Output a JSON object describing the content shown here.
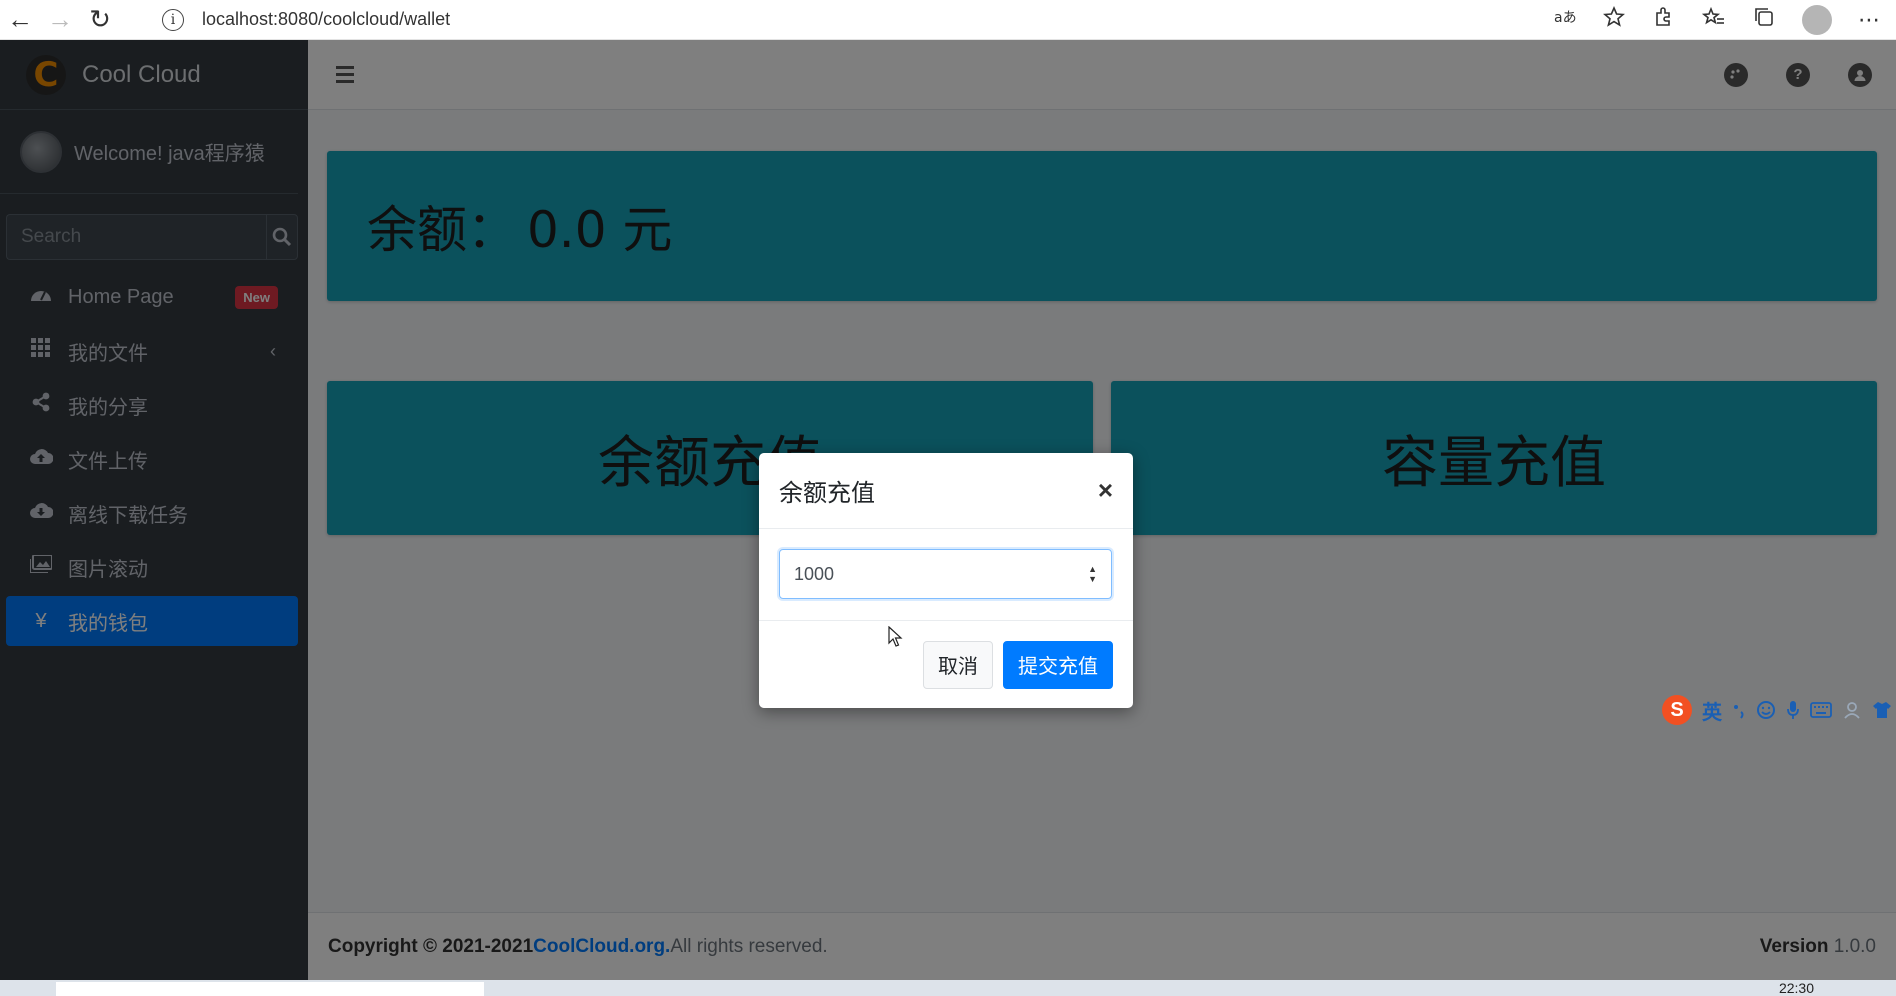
{
  "browser": {
    "url": "localhost:8080/coolcloud/wallet",
    "info_symbol": "i"
  },
  "sidebar": {
    "brand": "Cool Cloud",
    "brand_logo_letter": "C",
    "welcome": "Welcome! java程序猿",
    "search_placeholder": "Search",
    "items": [
      {
        "label": "Home Page",
        "icon": "dashboard-icon",
        "badge": "New"
      },
      {
        "label": "我的文件",
        "icon": "grid-icon",
        "chevron": "‹"
      },
      {
        "label": "我的分享",
        "icon": "share-icon"
      },
      {
        "label": "文件上传",
        "icon": "cloud-upload-icon"
      },
      {
        "label": "离线下载任务",
        "icon": "cloud-download-icon"
      },
      {
        "label": "图片滚动",
        "icon": "images-icon"
      },
      {
        "label": "我的钱包",
        "icon": "yen-icon",
        "active": true
      }
    ]
  },
  "main": {
    "balance_label": "余额：",
    "balance_value": "0.0 元",
    "actions": [
      "余额充值",
      "容量充值"
    ]
  },
  "modal": {
    "title": "余额充值",
    "close": "×",
    "amount_value": "1000",
    "cancel": "取消",
    "submit": "提交充值"
  },
  "footer": {
    "copyright_prefix": "Copyright © 2021-2021 ",
    "org": "CoolCloud.org.",
    "rights": " All rights reserved.",
    "version_label": "Version",
    "version_value": "1.0.0"
  },
  "ime": {
    "logo": "S",
    "lang": "英"
  },
  "taskbar": {
    "time": "22:30"
  },
  "colors": {
    "sidebar_bg": "#343a40",
    "info_box": "#17a2b8",
    "primary": "#007bff",
    "danger": "#dc3545"
  }
}
